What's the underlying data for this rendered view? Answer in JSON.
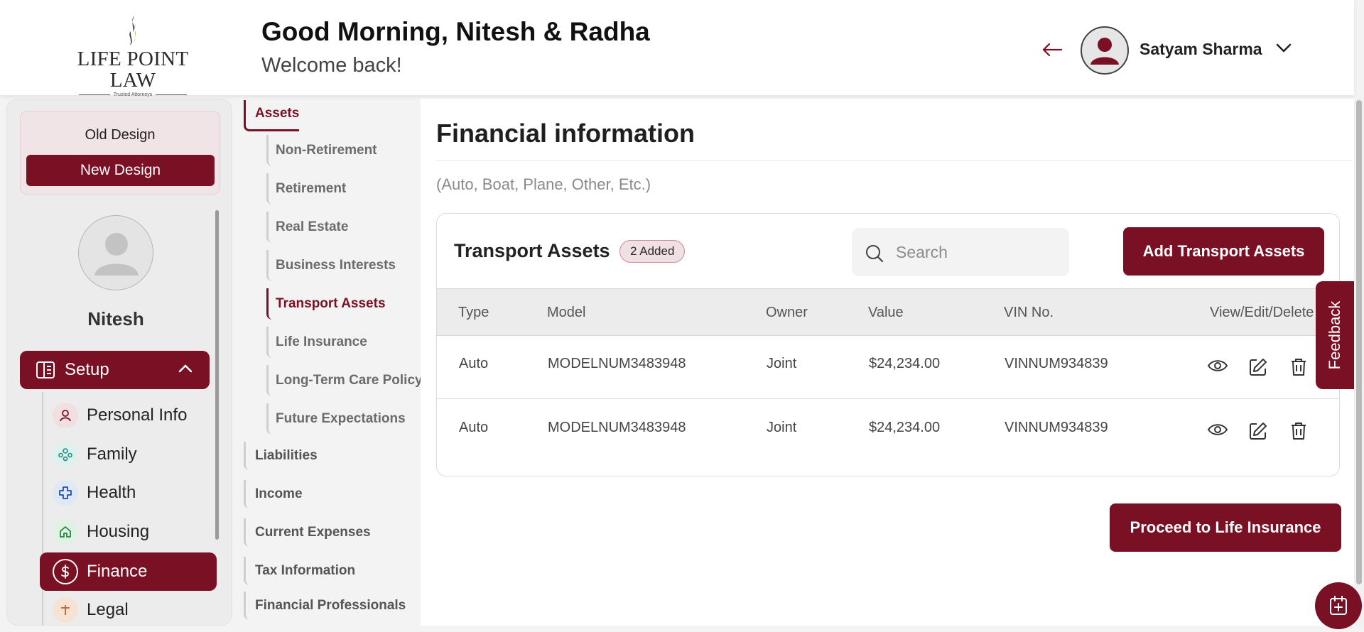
{
  "colors": {
    "accent": "#7a1024",
    "accent_light": "#f1e4e6"
  },
  "logo": {
    "text": "LIFE POINT LAW",
    "tagline": "Trusted Attorneys"
  },
  "header": {
    "greeting": "Good Morning, Nitesh & Radha",
    "subgreeting": "Welcome back!",
    "user_name": "Satyam Sharma"
  },
  "sidebar": {
    "old_design": "Old Design",
    "new_design": "New Design",
    "profile_name": "Nitesh",
    "setup_label": "Setup",
    "items": [
      {
        "label": "Personal Info",
        "icon": "person-icon"
      },
      {
        "label": "Family",
        "icon": "family-icon"
      },
      {
        "label": "Health",
        "icon": "health-cross-icon"
      },
      {
        "label": "Housing",
        "icon": "home-icon"
      },
      {
        "label": "Finance",
        "icon": "dollar-icon",
        "active": true
      },
      {
        "label": "Legal",
        "icon": "legal-icon"
      }
    ]
  },
  "subnav": {
    "assets": "Assets",
    "asset_items": [
      "Non-Retirement",
      "Retirement",
      "Real Estate",
      "Business Interests",
      "Transport Assets",
      "Life Insurance",
      "Long-Term Care Policy",
      "Future Expectations"
    ],
    "active_item": "Transport Assets",
    "groups": [
      "Liabilities",
      "Income",
      "Current Expenses",
      "Tax Information",
      "Financial Professionals"
    ]
  },
  "main": {
    "title": "Financial information",
    "subtitle": "(Auto, Boat, Plane, Other, Etc.)",
    "card_title": "Transport Assets",
    "badge": "2 Added",
    "search_placeholder": "Search",
    "add_button": "Add Transport Assets",
    "columns": [
      "Type",
      "Model",
      "Owner",
      "Value",
      "VIN No.",
      "View/Edit/Delete"
    ],
    "rows": [
      {
        "type": "Auto",
        "model": "MODELNUM3483948",
        "owner": "Joint",
        "value": "$24,234.00",
        "vin": "VINNUM934839"
      },
      {
        "type": "Auto",
        "model": "MODELNUM3483948",
        "owner": "Joint",
        "value": "$24,234.00",
        "vin": "VINNUM934839"
      }
    ],
    "proceed_button": "Proceed to Life Insurance"
  },
  "feedback_label": "Feedback"
}
